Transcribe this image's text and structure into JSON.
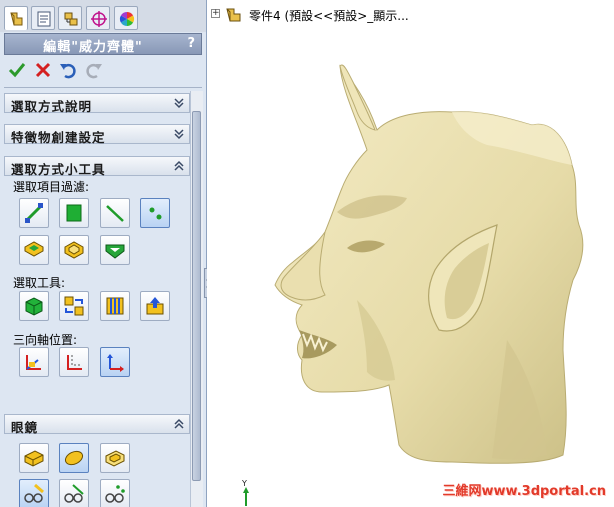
{
  "panel": {
    "tabs": [
      {
        "name": "feature-manager-tab",
        "icon": "feature-tree-icon"
      },
      {
        "name": "property-manager-tab",
        "icon": "property-sheet-icon"
      },
      {
        "name": "configuration-manager-tab",
        "icon": "configuration-icon"
      },
      {
        "name": "dimxpert-tab",
        "icon": "crosshair-icon"
      },
      {
        "name": "display-manager-tab",
        "icon": "color-wheel-icon"
      }
    ],
    "title": "編輯\"威力齊體\"",
    "help": "?",
    "actions": {
      "ok": "check-icon",
      "cancel": "close-icon",
      "undo": "undo-icon",
      "redo": "redo-icon"
    },
    "groups": {
      "select_help": "選取方式說明",
      "feature_setting": "特徵物創建設定",
      "select_tools": "選取方式小工具",
      "glasses": "眼鏡"
    },
    "filter_label": "選取項目過濾:",
    "tools_label": "選取工具:",
    "axis_label": "三向軸位置:",
    "accent": "#2f6fd1"
  },
  "tree": {
    "expand": "+",
    "text": "零件4 (預設<<預設>_顯示..."
  },
  "triad": {
    "y_label": "Y"
  },
  "watermark": "三維网www.3dportal.cn",
  "model": {
    "color": "#ece3b4",
    "shade": "#c2b784"
  }
}
